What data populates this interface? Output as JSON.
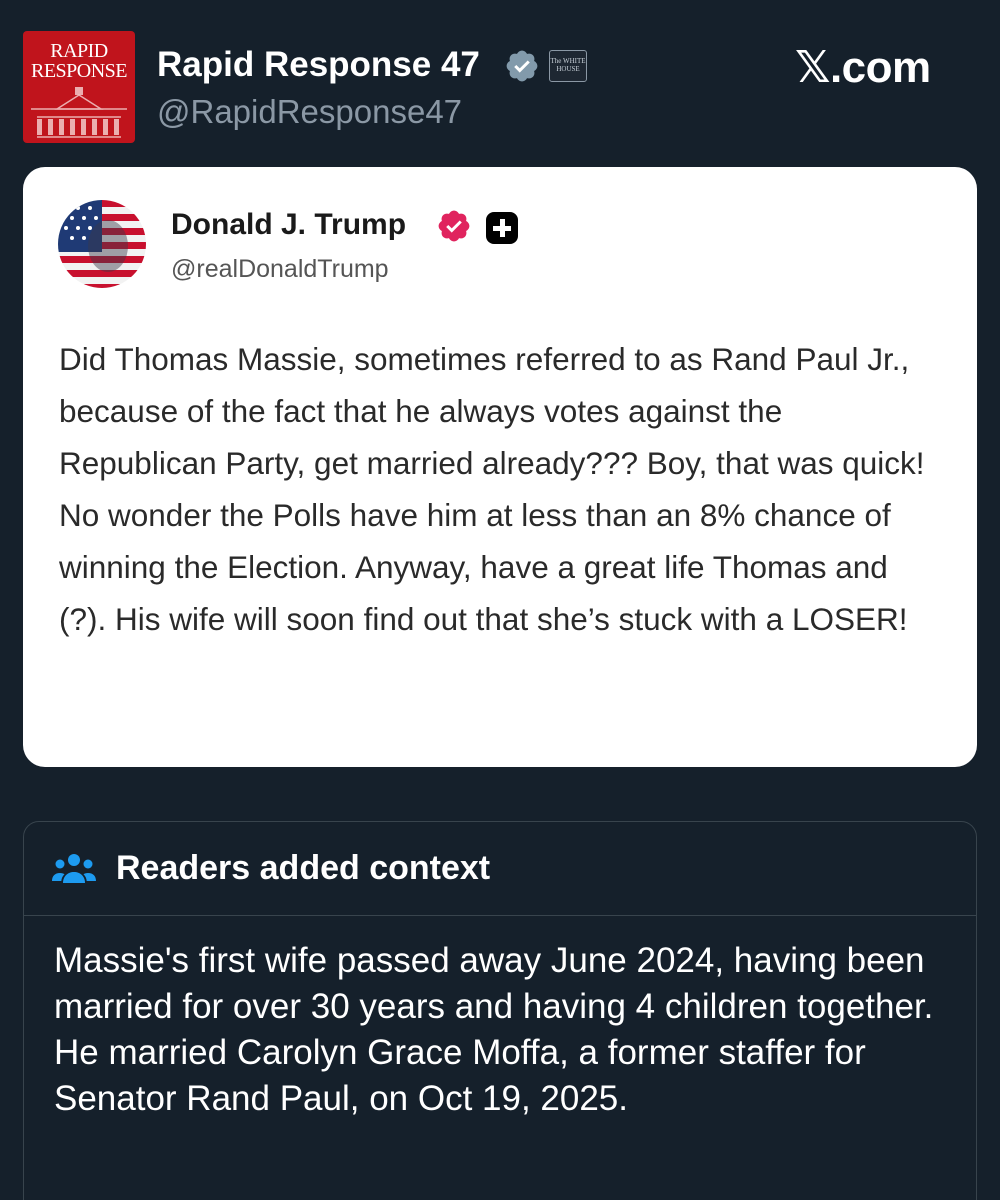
{
  "header": {
    "logo_text_line1": "RAPID",
    "logo_text_line2": "RESPONSE",
    "display_name": "Rapid Response 47",
    "handle": "@RapidResponse47",
    "affiliate_badge_text": "The WHITE HOUSE",
    "site_label": ".com",
    "site_mark": "𝕏",
    "verified_icon": "verified-gray-check-icon"
  },
  "post": {
    "author_name": "Donald J. Trump",
    "author_handle": "@realDonaldTrump",
    "verified_icon": "verified-red-check-icon",
    "extra_badge_icon": "plus-badge-icon",
    "text": "Did Thomas Massie, sometimes referred to as Rand Paul Jr., because of the fact that he always votes against the Republican Party, get married already??? Boy, that was quick! No wonder the Polls have him at less than an 8% chance of winning the Election. Anyway, have a great life Thomas and (?). His wife will soon find out that she’s stuck with a LOSER!"
  },
  "community_note": {
    "icon": "people-icon",
    "title": "Readers added context",
    "text": "Massie's first wife passed away June 2024, having been married for over 30 years and having 4 children together. He married Carolyn Grace Moffa, a former staffer for Senator Rand Paul, on Oct 19, 2025."
  },
  "colors": {
    "background": "#15202b",
    "card": "#ffffff",
    "logo_red": "#c0141c",
    "red_check": "#e0245e",
    "note_icon_blue": "#1d9bf0",
    "secondary_text": "#8b98a5"
  }
}
